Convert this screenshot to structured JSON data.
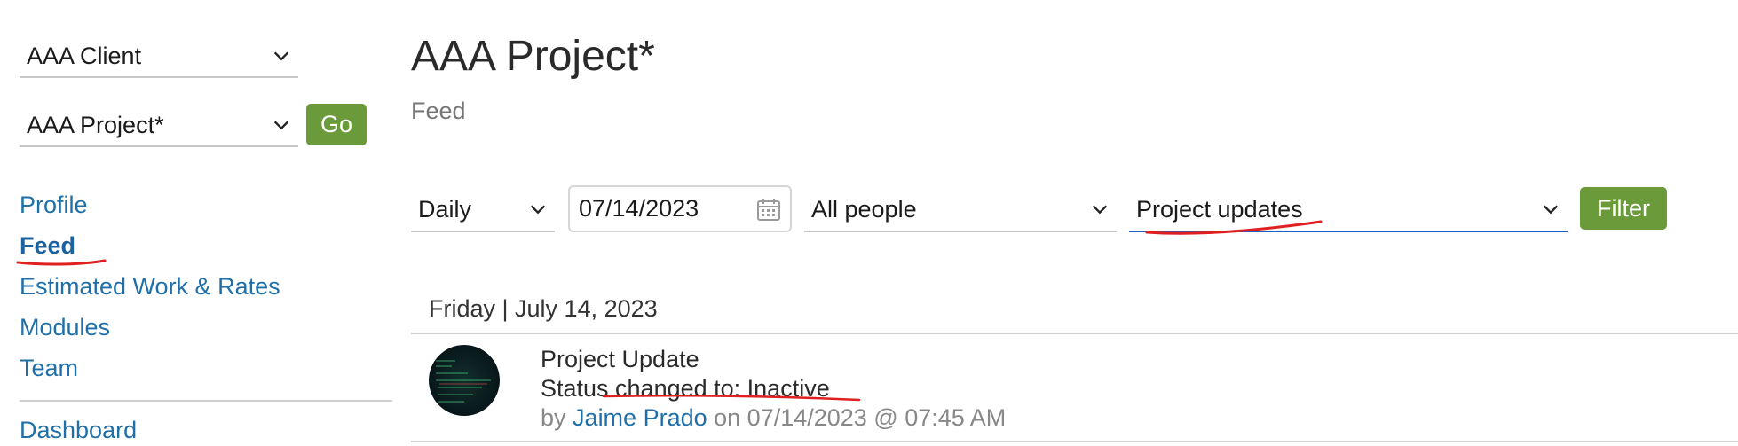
{
  "sidebar": {
    "client_select": "AAA Client",
    "project_select": "AAA Project*",
    "go_label": "Go",
    "nav": [
      {
        "label": "Profile"
      },
      {
        "label": "Feed"
      },
      {
        "label": "Estimated Work & Rates"
      },
      {
        "label": "Modules"
      },
      {
        "label": "Team"
      }
    ],
    "dashboard_label": "Dashboard"
  },
  "header": {
    "title": "AAA Project*",
    "subtitle": "Feed"
  },
  "filters": {
    "period": "Daily",
    "date": "07/14/2023",
    "people": "All people",
    "type": "Project updates",
    "filter_label": "Filter"
  },
  "feed": {
    "day_header": "Friday | July 14, 2023",
    "entries": [
      {
        "title": "Project Update",
        "detail": "Status changed to: Inactive",
        "by_prefix": "by",
        "author": "Jaime Prado",
        "timestamp": "on 07/14/2023 @ 07:45 AM"
      }
    ]
  },
  "colors": {
    "link": "#1f6fa8",
    "button_green": "#6a9a3a",
    "annotation_red": "#e02020",
    "focus_blue": "#1a62c8"
  }
}
